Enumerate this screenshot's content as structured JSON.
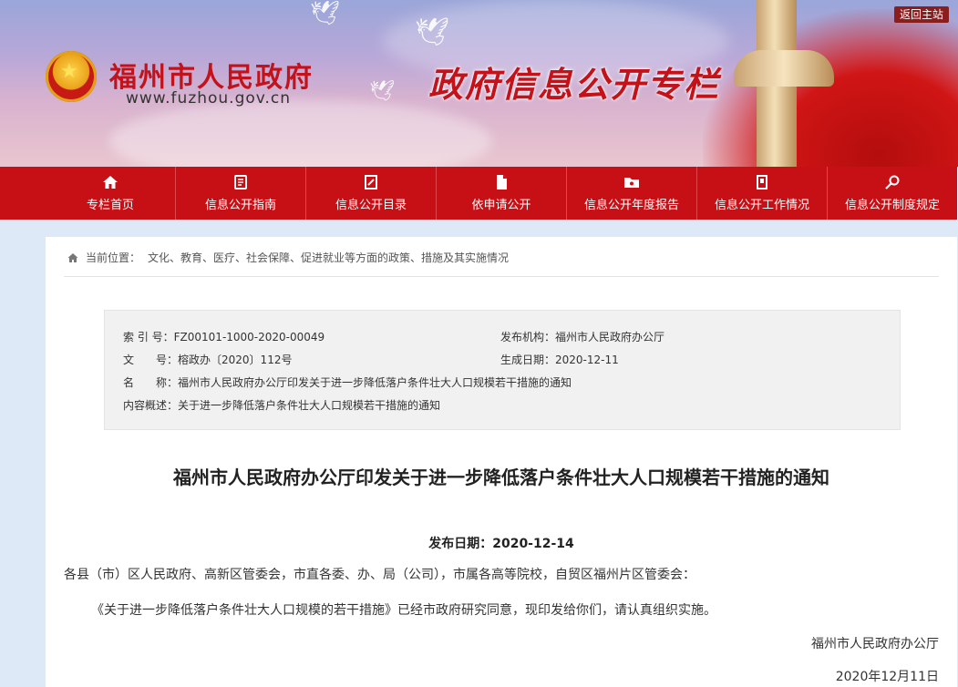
{
  "header": {
    "site_name": "福州市人民政府",
    "site_url": "www.fuzhou.gov.cn",
    "column_title": "政府信息公开专栏",
    "back_home": "返回主站"
  },
  "nav": [
    {
      "label": "专栏首页",
      "icon": "home-icon"
    },
    {
      "label": "信息公开指南",
      "icon": "guide-icon"
    },
    {
      "label": "信息公开目录",
      "icon": "catalog-icon"
    },
    {
      "label": "依申请公开",
      "icon": "document-icon"
    },
    {
      "label": "信息公开年度报告",
      "icon": "folder-icon"
    },
    {
      "label": "信息公开工作情况",
      "icon": "report-icon"
    },
    {
      "label": "信息公开制度规定",
      "icon": "search-rule-icon"
    }
  ],
  "breadcrumb": {
    "prefix": "当前位置：",
    "path": "文化、教育、医疗、社会保障、促进就业等方面的政策、措施及其实施情况"
  },
  "meta": {
    "index_label": "索 引 号：",
    "index_value": "FZ00101-1000-2020-00049",
    "publisher_label": "发布机构：",
    "publisher_value": "福州市人民政府办公厅",
    "doc_no_label": "文　　号：",
    "doc_no_value": "榕政办〔2020〕112号",
    "gen_date_label": "生成日期：",
    "gen_date_value": "2020-12-11",
    "name_label": "名　　称：",
    "name_value": "福州市人民政府办公厅印发关于进一步降低落户条件壮大人口规模若干措施的通知",
    "summary_label": "内容概述：",
    "summary_value": "关于进一步降低落户条件壮大人口规模若干措施的通知"
  },
  "article": {
    "title": "福州市人民政府办公厅印发关于进一步降低落户条件壮大人口规模若干措施的通知",
    "publish_date": "发布日期：2020-12-14",
    "recipients": "各县（市）区人民政府、高新区管委会，市直各委、办、局（公司），市属各高等院校，自贸区福州片区管委会：",
    "paragraph1": "《关于进一步降低落户条件壮大人口规模的若干措施》已经市政府研究同意，现印发给你们，请认真组织实施。",
    "signature": "福州市人民政府办公厅",
    "sign_date": "2020年12月11日"
  }
}
